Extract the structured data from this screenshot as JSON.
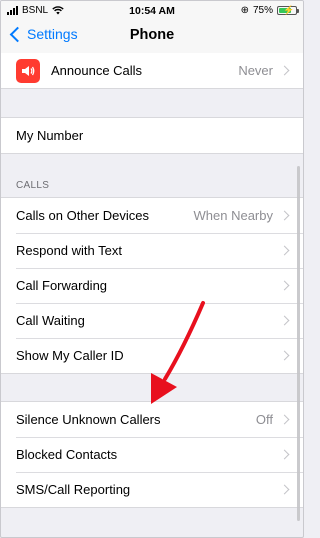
{
  "status_bar": {
    "carrier": "BSNL",
    "time": "10:54 AM",
    "battery": "75%",
    "battery_level": 0.75,
    "battery_color": "#35c759"
  },
  "nav": {
    "back_label": "Settings",
    "title": "Phone"
  },
  "groups": {
    "top": {
      "announce_calls": {
        "label": "Announce Calls",
        "value": "Never",
        "icon": "speaker-icon",
        "icon_color": "#ff3b30"
      }
    },
    "my_number": {
      "label": "My Number"
    },
    "calls_header": "CALLS",
    "calls": [
      {
        "label": "Calls on Other Devices",
        "value": "When Nearby"
      },
      {
        "label": "Respond with Text",
        "value": ""
      },
      {
        "label": "Call Forwarding",
        "value": ""
      },
      {
        "label": "Call Waiting",
        "value": ""
      },
      {
        "label": "Show My Caller ID",
        "value": ""
      }
    ],
    "blocking": [
      {
        "label": "Silence Unknown Callers",
        "value": "Off"
      },
      {
        "label": "Blocked Contacts",
        "value": ""
      },
      {
        "label": "SMS/Call Reporting",
        "value": ""
      }
    ]
  },
  "colors": {
    "accent": "#007aff",
    "annotation_arrow": "#e8101e",
    "background": "#efeff4"
  }
}
